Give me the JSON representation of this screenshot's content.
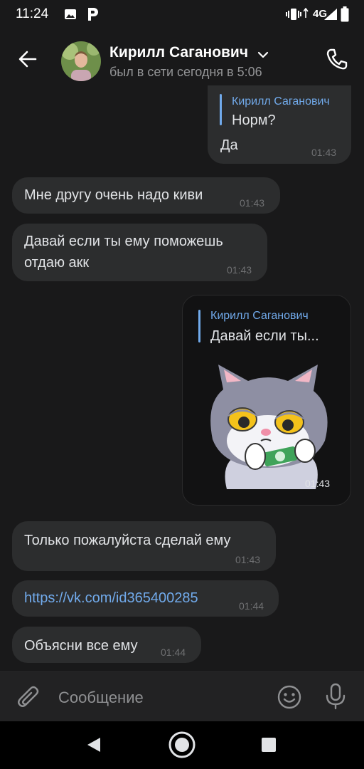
{
  "status_bar": {
    "time": "11:24",
    "network": "4G",
    "icons": [
      "gallery-icon",
      "parking-app-icon",
      "vibrate-icon",
      "signal-icon",
      "battery-icon"
    ]
  },
  "header": {
    "contact_name": "Кирилл Саганович",
    "contact_status": "был в сети сегодня в 5:06",
    "icons": [
      "back-arrow-icon",
      "chevron-down-icon",
      "phone-icon"
    ]
  },
  "messages": [
    {
      "direction": "outgoing",
      "reply_author": "Кирилл Саганович",
      "reply_text": "Норм?",
      "text": "Да",
      "time": "01:43"
    },
    {
      "direction": "incoming",
      "text": "Мне другу очень надо киви",
      "time": "01:43"
    },
    {
      "direction": "incoming",
      "text_lines": [
        "Давай если ты ему поможешь",
        "отдаю акк"
      ],
      "time": "01:43"
    },
    {
      "direction": "outgoing",
      "reply_author": "Кирилл Саганович",
      "reply_text": "Давай если ты...",
      "sticker": "grey-cat-holding-money-sticker",
      "time": "01:43"
    },
    {
      "direction": "incoming",
      "text": "Только пожалуйста сделай ему",
      "time": "01:43"
    },
    {
      "direction": "incoming",
      "link": "https://vk.com/id365400285",
      "time": "01:44"
    },
    {
      "direction": "incoming",
      "text": "Объясни все ему",
      "time": "01:44"
    }
  ],
  "composer": {
    "placeholder": "Сообщение",
    "icons": [
      "attach-icon",
      "emoji-icon",
      "microphone-icon"
    ]
  },
  "nav_bar": {
    "icons": [
      "nav-back-icon",
      "nav-home-icon",
      "nav-recents-icon"
    ]
  },
  "colors": {
    "background": "#19191a",
    "bubble": "#2c2d2e",
    "accent": "#71aaeb",
    "time": "#6f7072"
  }
}
